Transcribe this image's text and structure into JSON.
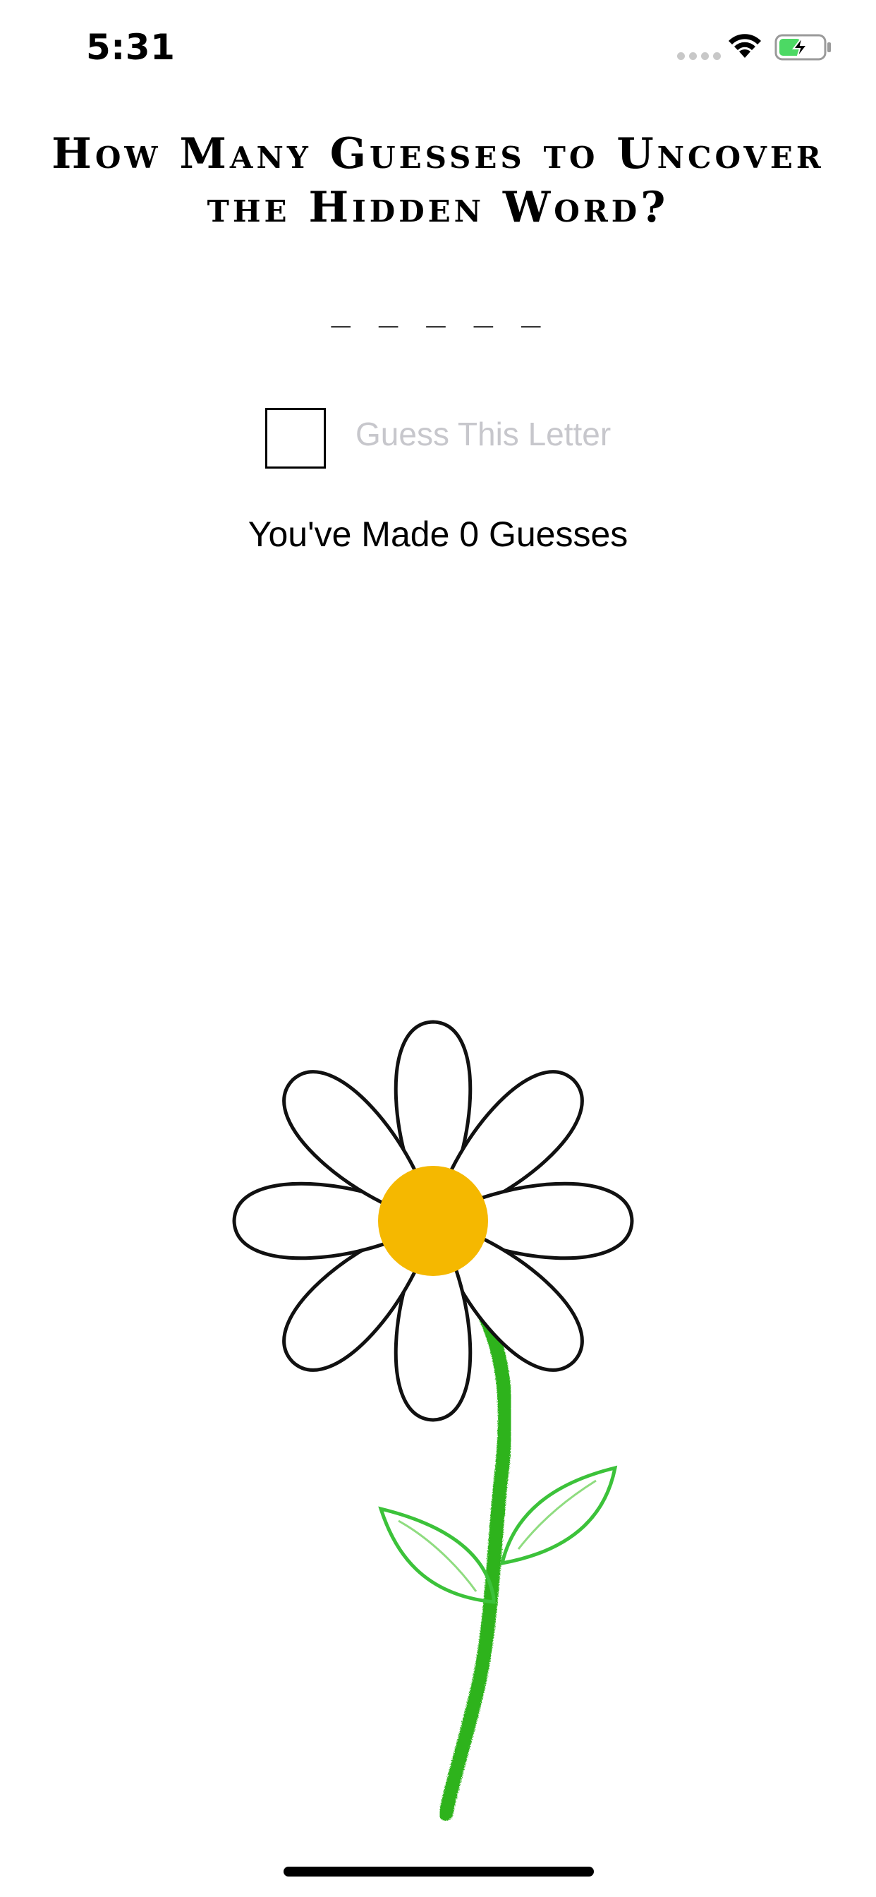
{
  "status_bar": {
    "time": "5:31",
    "icons": [
      "signal-icon",
      "wifi-icon",
      "battery-charging-icon"
    ],
    "battery_color": "#4cd964"
  },
  "game": {
    "title": "How Many Guesses to Uncover the Hidden Word?",
    "hidden_word": "_ _ _ _ _",
    "letter_input_value": "",
    "guess_button_label": "Guess This Letter",
    "guess_count_text": "You've Made 0 Guesses"
  },
  "flower": {
    "petal_count": 8,
    "center_color": "#f5b800",
    "stem_color": "#2fb31a",
    "leaf_color": "#3cc23a",
    "petal_stroke": "#111111"
  }
}
